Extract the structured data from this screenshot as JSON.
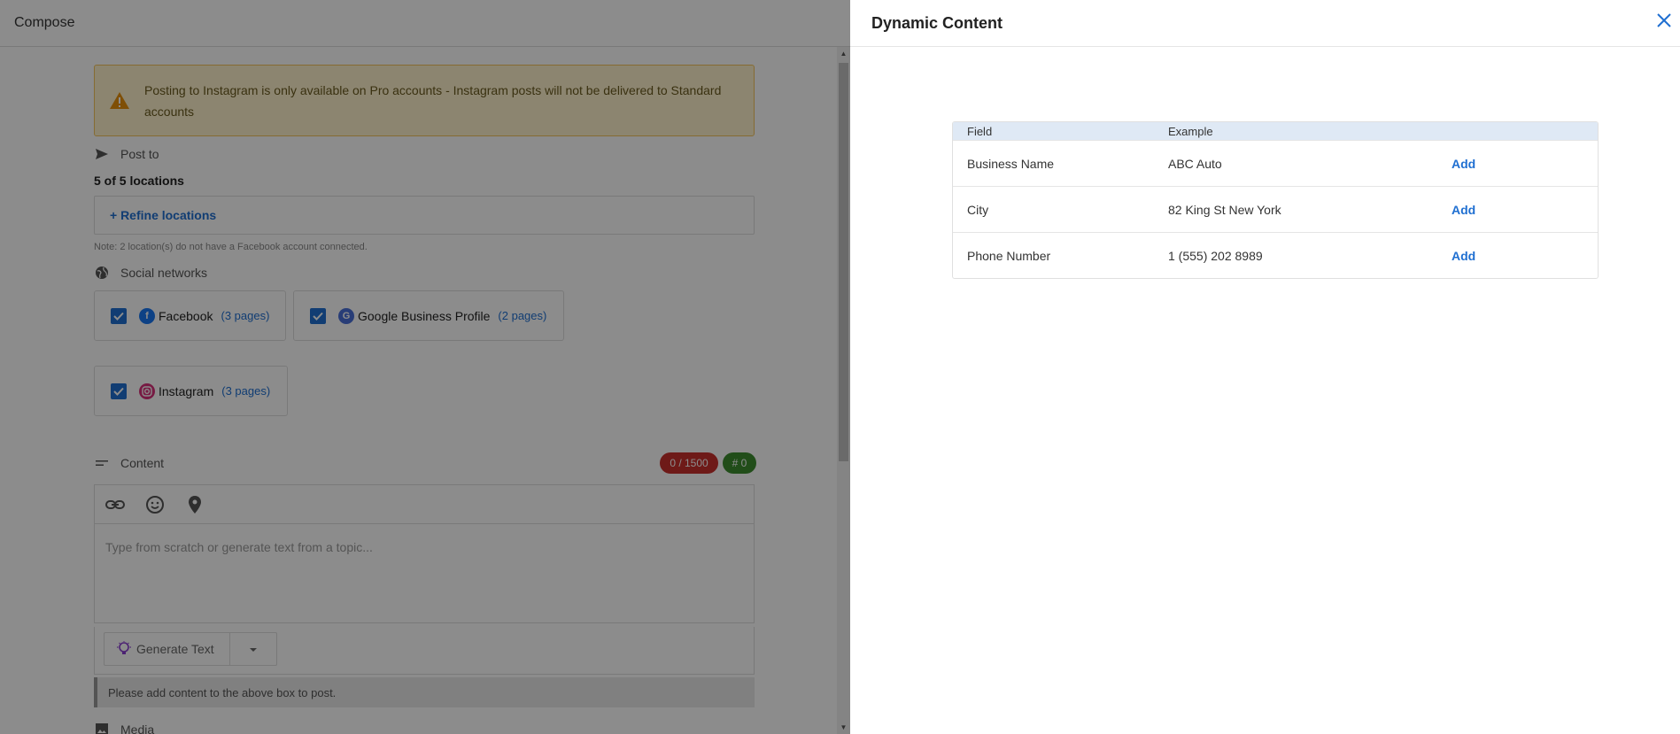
{
  "compose": {
    "title": "Compose",
    "warning": "Posting to Instagram is only available on Pro accounts - Instagram posts will not be delivered to Standard accounts",
    "post_to_label": "Post to",
    "locations_count": "5 of 5 locations",
    "refine_label": "+ Refine locations",
    "note": "Note: 2 location(s) do not have a Facebook account connected.",
    "social_label": "Social networks",
    "networks": [
      {
        "name": "Facebook",
        "pages": "(3 pages)",
        "icon": "facebook-icon",
        "color": "#1877f2"
      },
      {
        "name": "Google Business Profile",
        "pages": "(2 pages)",
        "icon": "google-business-icon",
        "color": "#4a6fd9"
      },
      {
        "name": "Instagram",
        "pages": "(3 pages)",
        "icon": "instagram-icon",
        "color": "#d9307a"
      }
    ],
    "content_label": "Content",
    "char_badge": "0 / 1500",
    "hash_badge": "# 0",
    "placeholder": "Type from scratch or generate text from a topic...",
    "generate_label": "Generate Text",
    "hint": "Please add content to the above box to post.",
    "media_label": "Media",
    "colors": {
      "badge_red": "#c9302c",
      "badge_green": "#3c8c2f",
      "accent": "#1f6fd1"
    }
  },
  "drawer": {
    "title": "Dynamic Content",
    "headers": [
      "Field",
      "Example",
      ""
    ],
    "rows": [
      {
        "field": "Business Name",
        "example": "ABC Auto",
        "action": "Add"
      },
      {
        "field": "City",
        "example": "82 King St New York",
        "action": "Add"
      },
      {
        "field": "Phone Number",
        "example": "1 (555) 202 8989",
        "action": "Add"
      }
    ]
  }
}
